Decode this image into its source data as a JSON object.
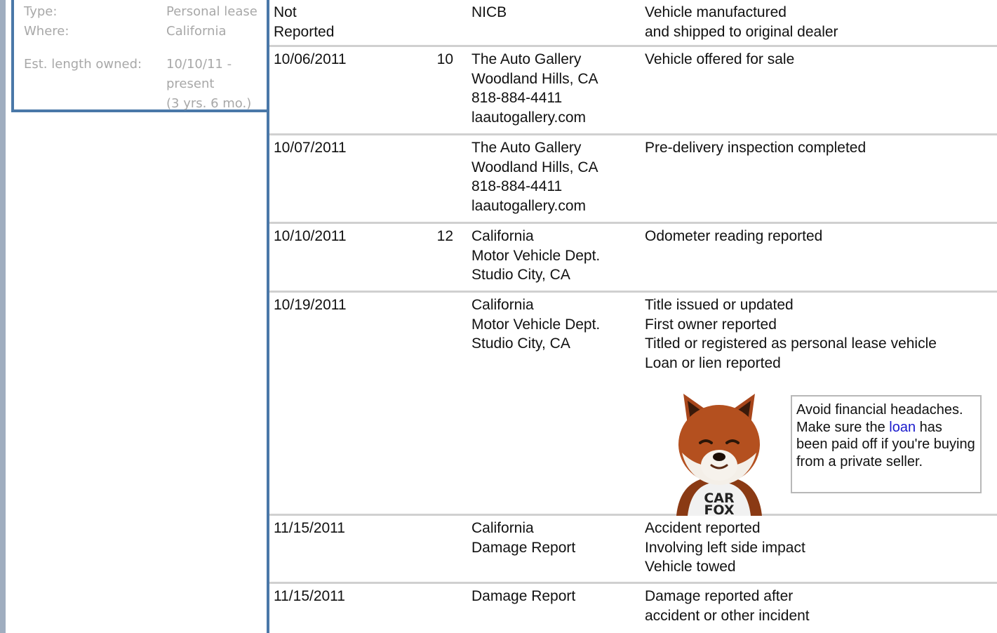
{
  "owner": {
    "type_label": "Type:",
    "type_value": "Personal lease",
    "where_label": "Where:",
    "where_value": "California",
    "length_label": "Est. length owned:",
    "length_value_lines": [
      "10/10/11 -",
      "present",
      "(3 yrs. 6 mo.)"
    ]
  },
  "history": [
    {
      "date": [
        "Not",
        "Reported"
      ],
      "odometer": "",
      "source": [
        "NICB"
      ],
      "comments": [
        "Vehicle manufactured",
        "and shipped to original dealer"
      ]
    },
    {
      "date": [
        "10/06/2011"
      ],
      "odometer": "10",
      "source": [
        "The Auto Gallery",
        "Woodland Hills, CA",
        "818-884-4411",
        "laautogallery.com"
      ],
      "comments": [
        "Vehicle offered for sale"
      ]
    },
    {
      "date": [
        "10/07/2011"
      ],
      "odometer": "",
      "source": [
        "The Auto Gallery",
        "Woodland Hills, CA",
        "818-884-4411",
        "laautogallery.com"
      ],
      "comments": [
        "Pre-delivery inspection completed"
      ]
    },
    {
      "date": [
        "10/10/2011"
      ],
      "odometer": "12",
      "source": [
        "California",
        "Motor Vehicle Dept.",
        "Studio City, CA"
      ],
      "comments": [
        "Odometer reading reported"
      ]
    },
    {
      "date": [
        "10/19/2011"
      ],
      "odometer": "",
      "source": [
        "California",
        "Motor Vehicle Dept.",
        "Studio City, CA"
      ],
      "comments": [
        "Title issued or updated",
        "First owner reported",
        "Titled or registered as personal lease vehicle",
        "Loan or lien reported"
      ]
    },
    {
      "date": [
        "11/15/2011"
      ],
      "odometer": "",
      "source": [
        "California",
        "Damage Report"
      ],
      "comments": [
        "Accident reported",
        "Involving left side impact",
        "Vehicle towed"
      ]
    },
    {
      "date": [
        "11/15/2011"
      ],
      "odometer": "",
      "source": [
        "Damage Report"
      ],
      "comments": [
        "Damage reported after",
        "accident or other incident"
      ]
    }
  ],
  "tip": {
    "before": "Avoid financial headaches. Make sure the",
    "link": "loan",
    "after": "has been paid off if you're buying from a private seller.",
    "mascot_text": [
      "CAR",
      "FOX"
    ]
  },
  "colors": {
    "accent": "#4a78a8",
    "muted_text": "#a8a8a8",
    "link": "#1a1acc",
    "row_rule": "#d0d0d0"
  }
}
